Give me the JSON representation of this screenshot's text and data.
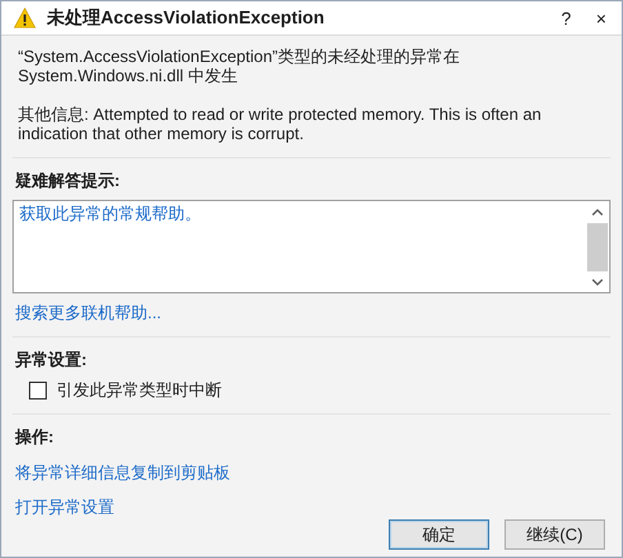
{
  "window": {
    "title": "未处理AccessViolationException",
    "title_buttons": [
      "?",
      "×"
    ]
  },
  "message": "“System.AccessViolationException”类型的未经处理的异常在 System.Windows.ni.dll 中发生",
  "additional_info": "其他信息: Attempted to read or write protected memory. This is often an indication that other memory is corrupt.",
  "troubleshooting": {
    "heading": "疑难解答提示:",
    "tips": [
      "获取此异常的常规帮助。"
    ],
    "link": "搜索更多联机帮助..."
  },
  "exception_settings": {
    "heading": "异常设置:",
    "options": [
      {
        "label": "引发此异常类型时中断",
        "checked": false
      }
    ]
  },
  "actions": {
    "heading": "操作:",
    "links": [
      "将异常详细信息复制到剪贴板",
      "打开异常设置"
    ]
  },
  "buttons": [
    {
      "label": "确定",
      "default": true
    },
    {
      "label": "继续(C)",
      "default": false
    }
  ]
}
